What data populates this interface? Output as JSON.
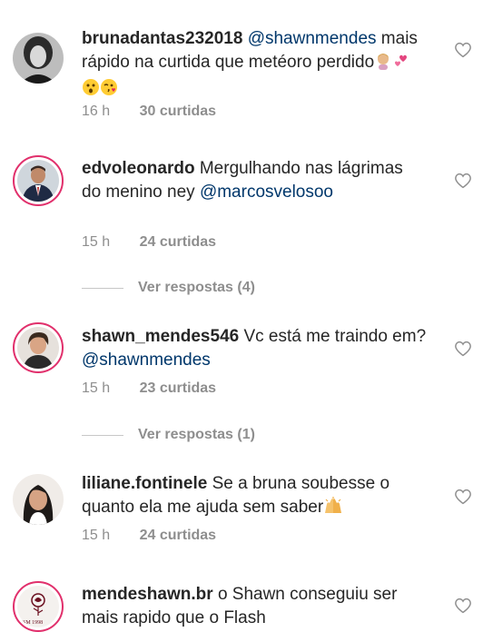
{
  "comments": [
    {
      "username": "brunadantas232018",
      "mention": "@shawnmendes",
      "text": "mais rápido na curtida que metéoro perdido",
      "time": "16 h",
      "likes": "30 curtidas"
    },
    {
      "username": "edvoleonardo",
      "text": "Mergulhando nas lágrimas do menino ney",
      "mention": "@marcosvelosoo",
      "time": "15 h",
      "likes": "24 curtidas",
      "replies": "Ver respostas (4)"
    },
    {
      "username": "shawn_mendes546",
      "text": "Vc está me traindo em?",
      "mention": "@shawnmendes",
      "time": "15 h",
      "likes": "23 curtidas",
      "replies": "Ver respostas (1)"
    },
    {
      "username": "liliane.fontinele",
      "text": "Se a bruna soubesse o quanto ela me ajuda sem saber",
      "time": "15 h",
      "likes": "24 curtidas"
    },
    {
      "username": "mendeshawn.br",
      "text": "o Shawn conseguiu ser mais rapido que o Flash",
      "avatar_text": "SM 1998"
    }
  ],
  "icons": {
    "heart": "heart-outline-icon",
    "emojis_comment1": [
      "woman-shrugging-emoji",
      "two-hearts-emoji",
      "astonished-face-emoji",
      "face-blowing-kiss-emoji"
    ],
    "emoji_comment4": "raising-hands-emoji"
  },
  "colors": {
    "mention": "#00376b",
    "meta": "#8e8e8e",
    "story_ring": "#e1306c"
  }
}
